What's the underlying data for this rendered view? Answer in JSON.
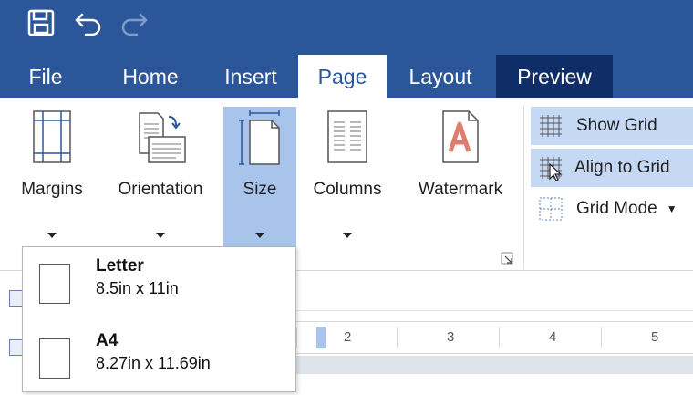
{
  "tabs": [
    {
      "label": "File"
    },
    {
      "label": "Home"
    },
    {
      "label": "Insert"
    },
    {
      "label": "Page"
    },
    {
      "label": "Layout"
    },
    {
      "label": "Preview"
    }
  ],
  "active_tab": "Page",
  "ribbon": {
    "buttons": [
      {
        "label": "Margins"
      },
      {
        "label": "Orientation"
      },
      {
        "label": "Size"
      },
      {
        "label": "Columns"
      },
      {
        "label": "Watermark"
      }
    ],
    "grid": {
      "show_grid": "Show Grid",
      "align_to_grid": "Align to Grid",
      "grid_mode": "Grid Mode"
    }
  },
  "size_menu": {
    "items": [
      {
        "name": "Letter",
        "dims": "8.5in x 11in"
      },
      {
        "name": "A4",
        "dims": "8.27in x 11.69in"
      }
    ]
  },
  "ruler": {
    "numbers": [
      "2",
      "3",
      "4",
      "5"
    ]
  },
  "colors": {
    "accent": "#2b579a",
    "preview_tab": "#0f2d66",
    "selected": "#a9c4ea"
  }
}
